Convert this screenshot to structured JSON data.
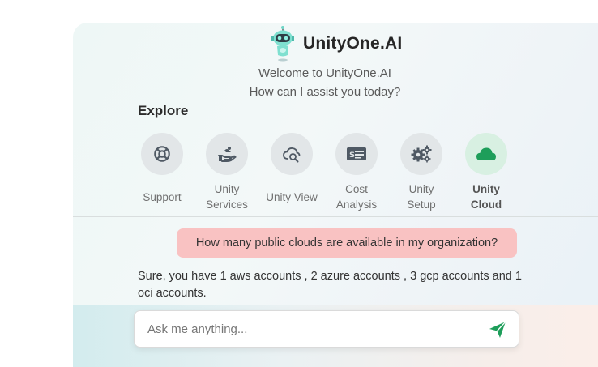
{
  "brand": {
    "name": "UnityOne.AI",
    "accent": "#6fd6c7"
  },
  "welcome": {
    "line1": "Welcome to UnityOne.AI",
    "line2": "How can I assist you today?"
  },
  "explore": {
    "title": "Explore",
    "items": [
      {
        "label": "Support",
        "icon": "lifebuoy-icon"
      },
      {
        "label": "Unity\nServices",
        "icon": "hand-service-icon"
      },
      {
        "label": "Unity View",
        "icon": "cloud-search-icon"
      },
      {
        "label": "Cost\nAnalysis",
        "icon": "cash-icon"
      },
      {
        "label": "Unity\nSetup",
        "icon": "gears-icon"
      },
      {
        "label": "Unity\nCloud",
        "icon": "cloud-icon",
        "active": true
      }
    ]
  },
  "chat": {
    "user_message": "How many public clouds are available in my organization?",
    "bot_message": "Sure, you have 1 aws accounts , 2 azure accounts , 3 gcp accounts and 1 oci accounts."
  },
  "composer": {
    "placeholder": "Ask me anything...",
    "send_icon": "send-icon",
    "send_color": "#1e9e5a"
  },
  "colors": {
    "user_bubble": "#f9c2c2",
    "active_circle": "#d8f0e2",
    "icon_gray": "#4f5964",
    "cloud_green": "#1e9e5a"
  }
}
